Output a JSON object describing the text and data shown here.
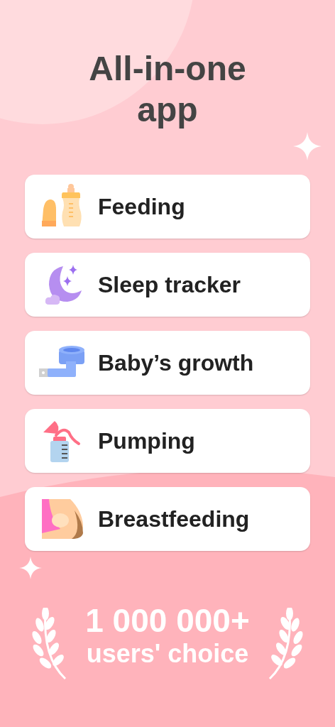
{
  "title": "All-in-one app",
  "features": [
    {
      "label": "Feeding"
    },
    {
      "label": "Sleep tracker"
    },
    {
      "label": "Baby’s growth"
    },
    {
      "label": "Pumping"
    },
    {
      "label": "Breastfeeding"
    }
  ],
  "badge": {
    "count": "1 000 000+",
    "caption": "users' choice"
  }
}
